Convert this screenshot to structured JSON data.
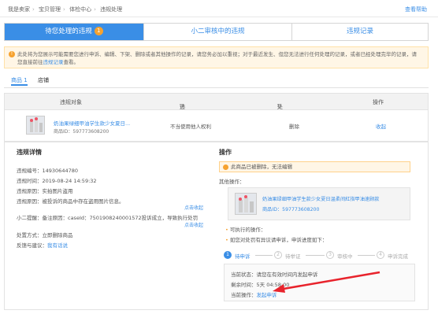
{
  "breadcrumb": {
    "items": [
      "我是卖家",
      "宝贝管理",
      "体检中心",
      "违规处理"
    ],
    "help": "查看帮助"
  },
  "tabs": [
    {
      "label": "待您处理的违规",
      "badge": "1"
    },
    {
      "label": "小二审核中的违规"
    },
    {
      "label": "违规记录"
    }
  ],
  "notice": {
    "line1": "此处将为您展示可能需要您进行申诉、编辑、下架、删除或者其他操作的记录，请您务必加以重视；对于最近发生、但您无法进行任何处理的记录，或者已经处理完毕的记录，请",
    "line2_link": "违规记录",
    "line2_pre": "您直接前往",
    "line2_post": "查看。"
  },
  "subtabs": [
    "商品 1",
    "店铺"
  ],
  "table": {
    "headers": {
      "object": "违规对象",
      "type": "违规类型",
      "method": "处置方式",
      "action": "操作"
    },
    "row": {
      "title": "奶油果绿细甲油学生款少女夏日...",
      "item_id": "商品ID：597773608200",
      "type": "不当使用他人权利",
      "method": "删除",
      "action": "收起"
    }
  },
  "detail": {
    "title": "违规详情",
    "fields": [
      {
        "label": "违规编号：",
        "value": "14930644780"
      },
      {
        "label": "违规时间：",
        "value": "2019-08-24 14:59:32"
      },
      {
        "label": "违规原因：",
        "value": "实拍图片盗用"
      },
      {
        "label": "违规原因：",
        "value": "被投诉的商品中存在盗用图片信息。"
      }
    ],
    "collapse1": "点击收起",
    "note_label": "小二提醒：",
    "note_value": "备注原因：caseId：7501908240001572投诉成立，导致执行处罚",
    "collapse2": "点击收起",
    "dispose_label": "处置方式：",
    "dispose_value": "立即删除商品",
    "feedback_label": "反馈与建议：",
    "feedback_link": "我有话说"
  },
  "ops": {
    "title": "操作",
    "deleted_msg": "此商品已被删除，无法编辑",
    "other_ops": "其他操作：",
    "item_title": "奶油果绿细甲油学生款少女夏日温柔间紅指甲油速顾款",
    "item_id": "商品ID：597773608200",
    "exec_label": "可执行的操作：",
    "appeal_hint": "如您对处罚有异议请申诉，申诉进度如下：",
    "steps": [
      {
        "n": "1",
        "label": "待申诉"
      },
      {
        "n": "2",
        "label": "待举证"
      },
      {
        "n": "3",
        "label": "审核中"
      },
      {
        "n": "4",
        "label": "申诉完成"
      }
    ],
    "status_label": "当前状态：",
    "status_value": "请您在有效时间内发起申诉",
    "remain_label": "剩余时间：",
    "remain_value": "5天 04:58:00",
    "op_label": "当前操作：",
    "op_link": "发起申诉"
  },
  "colors": {
    "accent": "#3a8ee6",
    "badge": "#f6a22f",
    "arrow": "#e8232c"
  }
}
